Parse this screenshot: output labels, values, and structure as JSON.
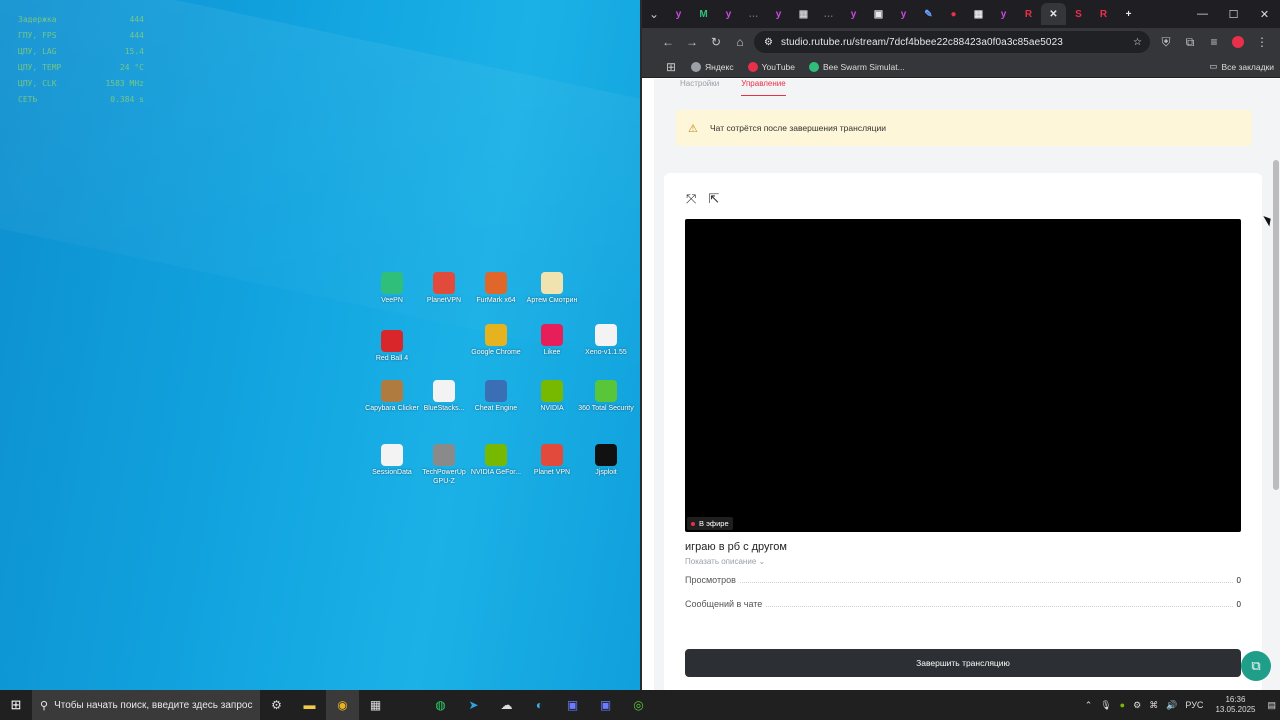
{
  "desktop": {
    "osd": [
      {
        "label": "Задержка",
        "value": "444"
      },
      {
        "label": "ГПУ, FPS",
        "value": "444"
      },
      {
        "label": "ЦПУ, LAG",
        "value": "15.4"
      },
      {
        "label": "ЦПУ, TEMP",
        "value": "24 °C"
      },
      {
        "label": "ЦПУ, CLK",
        "value": "1583 MHz"
      },
      {
        "label": "СЕТЬ",
        "value": "0.384 s"
      }
    ],
    "icons": [
      {
        "label": "VeePN",
        "color": "#2fbf7a"
      },
      {
        "label": "PlanetVPN",
        "color": "#e24a3b"
      },
      {
        "label": "FurMark x64",
        "color": "#e0672a"
      },
      {
        "label": "Артем Смотрин",
        "color": "#f1e3b0"
      },
      {
        "label": "Red Ball 4",
        "color": "#d8262a"
      },
      {
        "label": "Google Chrome",
        "color": "#e6b320"
      },
      {
        "label": "Likee",
        "color": "#e61e5a"
      },
      {
        "label": "Xeno-v1.1.55",
        "color": "#f3f3f3"
      },
      {
        "label": "Capybara Clicker",
        "color": "#b07b3f"
      },
      {
        "label": "BlueStacks...",
        "color": "#f3f3f3"
      },
      {
        "label": "Cheat Engine",
        "color": "#3a6fb5"
      },
      {
        "label": "NVIDIA",
        "color": "#76b900"
      },
      {
        "label": "360 Total Security",
        "color": "#59c63a"
      },
      {
        "label": "SessionData",
        "color": "#f3f3f3"
      },
      {
        "label": "TechPowerUp GPU-Z",
        "color": "#8a8a8a"
      },
      {
        "label": "NVIDIA GeFor...",
        "color": "#76b900"
      },
      {
        "label": "Planet VPN",
        "color": "#e24a3b"
      },
      {
        "label": "Jjsploit",
        "color": "#111111"
      }
    ]
  },
  "browser": {
    "tabs": [
      {
        "glyph": "y",
        "color": "#c74bdf"
      },
      {
        "glyph": "M",
        "color": "#2fbf7a"
      },
      {
        "glyph": "y",
        "color": "#c74bdf"
      },
      {
        "glyph": "…",
        "color": "#666666"
      },
      {
        "glyph": "y",
        "color": "#c74bdf"
      },
      {
        "glyph": "▦",
        "color": "#cccccc"
      },
      {
        "glyph": "…",
        "color": "#666666"
      },
      {
        "glyph": "y",
        "color": "#c74bdf"
      },
      {
        "glyph": "▣",
        "color": "#e8e8e8"
      },
      {
        "glyph": "y",
        "color": "#c74bdf"
      },
      {
        "glyph": "✎",
        "color": "#6aa0ff"
      },
      {
        "glyph": "●",
        "color": "#e8304a"
      },
      {
        "glyph": "▦",
        "color": "#e8e8e8"
      },
      {
        "glyph": "y",
        "color": "#c74bdf"
      },
      {
        "glyph": "R",
        "color": "#e8304a"
      },
      {
        "glyph": "✕",
        "color": "#e8e8e8",
        "active": true
      },
      {
        "glyph": "S",
        "color": "#e8304a"
      },
      {
        "glyph": "R",
        "color": "#e8304a"
      },
      {
        "glyph": "+",
        "color": "#e8e8e8"
      }
    ],
    "url": "studio.rutube.ru/stream/7dcf4bbee22c88423a0f0a3c85ae5023",
    "bookmarks": [
      {
        "label": "Яндекс",
        "color": "#9aa0a6"
      },
      {
        "label": "YouTube",
        "color": "#e8304a"
      },
      {
        "label": "Bee Swarm Simulat...",
        "color": "#2fbf7a"
      }
    ],
    "all_bookmarks": "Все закладки"
  },
  "page": {
    "tabs": [
      "Настройки",
      "Управление"
    ],
    "active_tab": "Управление",
    "warning": "Чат сотрётся после завершения трансляции",
    "live_badge": "В эфире",
    "stream_title": "играю в рб с другом",
    "show_description": "Показать описание",
    "stats": [
      {
        "label": "Просмотров",
        "value": "0"
      },
      {
        "label": "Сообщений в чате",
        "value": "0"
      }
    ],
    "end_button": "Завершить трансляцию"
  },
  "taskbar": {
    "search_placeholder": "Чтобы начать поиск, введите здесь запрос",
    "language": "РУС",
    "time": "16:36",
    "date": "13.05.2025"
  }
}
